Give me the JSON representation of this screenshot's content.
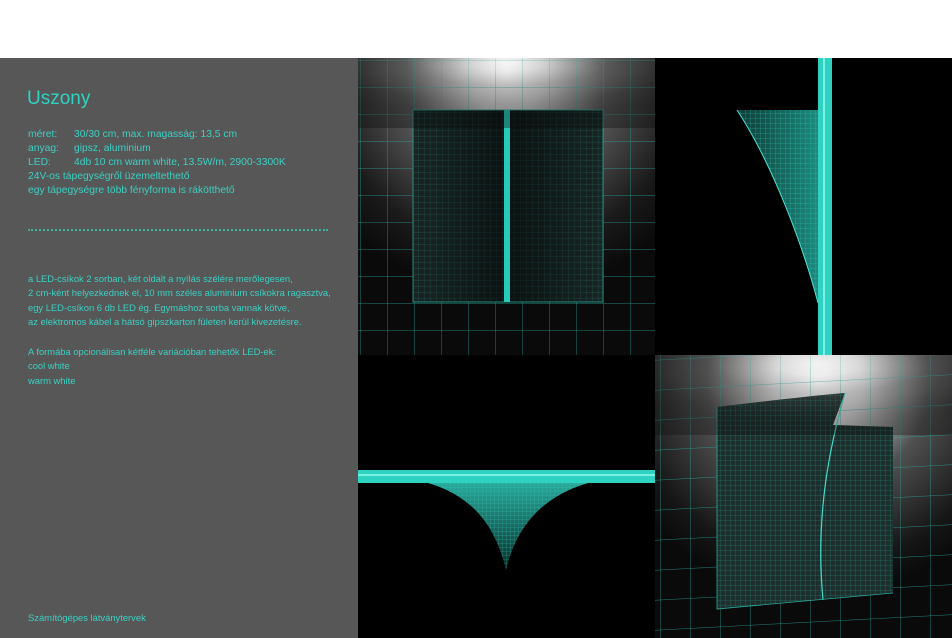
{
  "title": "Uszony",
  "specs": [
    {
      "label": "méret:",
      "value": "30/30 cm, max. magasság:   13,5 cm"
    },
    {
      "label": "anyag:",
      "value": "gipsz, aluminium"
    },
    {
      "label": "LED:",
      "value": "4db 10 cm warm white, 13.5W/m, 2900-3300K"
    }
  ],
  "notes": [
    "24V-os tápegységről üzemeltethető",
    "egy tápegységre több fényforma is rákötthető"
  ],
  "description": [
    "a LED-csíkok 2 sorban, két oldalt a nyílás szélére merőlegesen,",
    "2 cm-ként helyezkednek el, 10 mm széles aluminium csíkokra ragasztva,",
    "egy LED-csíkon 6 db  LED ég. Egymáshoz sorba vannak kötve,",
    "az elektromos kábel a hátsó gipszkarton fületen kerül  kivezetésre."
  ],
  "options": {
    "intro": "A formába opcionálisan kétféle variációban tehetők LED-ek:",
    "items": [
      "cool white",
      "warm white"
    ]
  },
  "footer": "Számítógépes látványtervek",
  "colors": {
    "accent": "#2ed3c3",
    "panel_bg": "#575757",
    "render_bg": "#000000"
  }
}
